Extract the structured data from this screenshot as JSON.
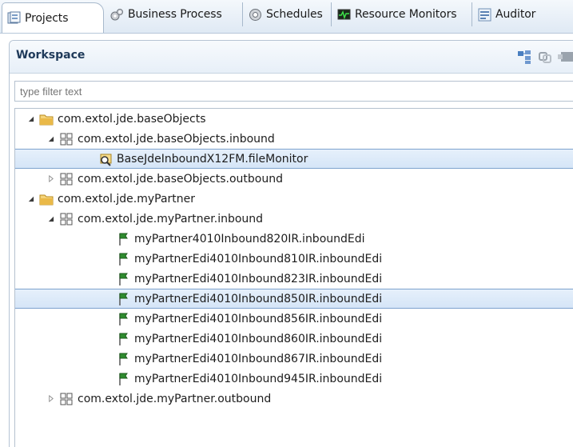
{
  "tabs": [
    {
      "label": "Projects",
      "icon": "projects-icon",
      "active": true
    },
    {
      "label": "Business Process",
      "icon": "gears-icon",
      "active": false
    },
    {
      "label": "Schedules",
      "icon": "schedule-gear-icon",
      "active": false
    },
    {
      "label": "Resource Monitors",
      "icon": "monitor-icon",
      "active": false
    },
    {
      "label": "Auditor",
      "icon": "auditor-icon",
      "active": false
    }
  ],
  "workspace": {
    "title": "Workspace",
    "filter_placeholder": "type filter text",
    "toolbar_icons": [
      "collapse-all-icon",
      "link-icon",
      "view-menu-icon"
    ]
  },
  "tree": [
    {
      "label": "com.extol.jde.baseObjects",
      "icon": "folder-icon",
      "expanded": true,
      "level": 0
    },
    {
      "label": "com.extol.jde.baseObjects.inbound",
      "icon": "package-icon",
      "expanded": true,
      "level": 1
    },
    {
      "label": "BaseJdeInboundX12FM.fileMonitor",
      "icon": "file-monitor-icon",
      "level": 2,
      "selected": true
    },
    {
      "label": "com.extol.jde.baseObjects.outbound",
      "icon": "package-icon",
      "expanded": false,
      "level": 1
    },
    {
      "label": "com.extol.jde.myPartner",
      "icon": "folder-icon",
      "expanded": true,
      "level": 0
    },
    {
      "label": "com.extol.jde.myPartner.inbound",
      "icon": "package-icon",
      "expanded": true,
      "level": 1
    },
    {
      "label": "myPartner4010Inbound820IR.inboundEdi",
      "icon": "flag-icon",
      "level": 3
    },
    {
      "label": "myPartnerEdi4010Inbound810IR.inboundEdi",
      "icon": "flag-icon",
      "level": 3
    },
    {
      "label": "myPartnerEdi4010Inbound823IR.inboundEdi",
      "icon": "flag-icon",
      "level": 3
    },
    {
      "label": "myPartnerEdi4010Inbound850IR.inboundEdi",
      "icon": "flag-icon",
      "level": 3,
      "selected": true
    },
    {
      "label": "myPartnerEdi4010Inbound856IR.inboundEdi",
      "icon": "flag-icon",
      "level": 3
    },
    {
      "label": "myPartnerEdi4010Inbound860IR.inboundEdi",
      "icon": "flag-icon",
      "level": 3
    },
    {
      "label": "myPartnerEdi4010Inbound867IR.inboundEdi",
      "icon": "flag-icon",
      "level": 3
    },
    {
      "label": "myPartnerEdi4010Inbound945IR.inboundEdi",
      "icon": "flag-icon",
      "level": 3
    },
    {
      "label": "com.extol.jde.myPartner.outbound",
      "icon": "package-icon",
      "expanded": false,
      "level": 1
    }
  ],
  "colors": {
    "accent": "#1f3a5a",
    "selection": "#d5e5f7",
    "flag": "#2e8b2e",
    "folder": "#e8b84a"
  }
}
